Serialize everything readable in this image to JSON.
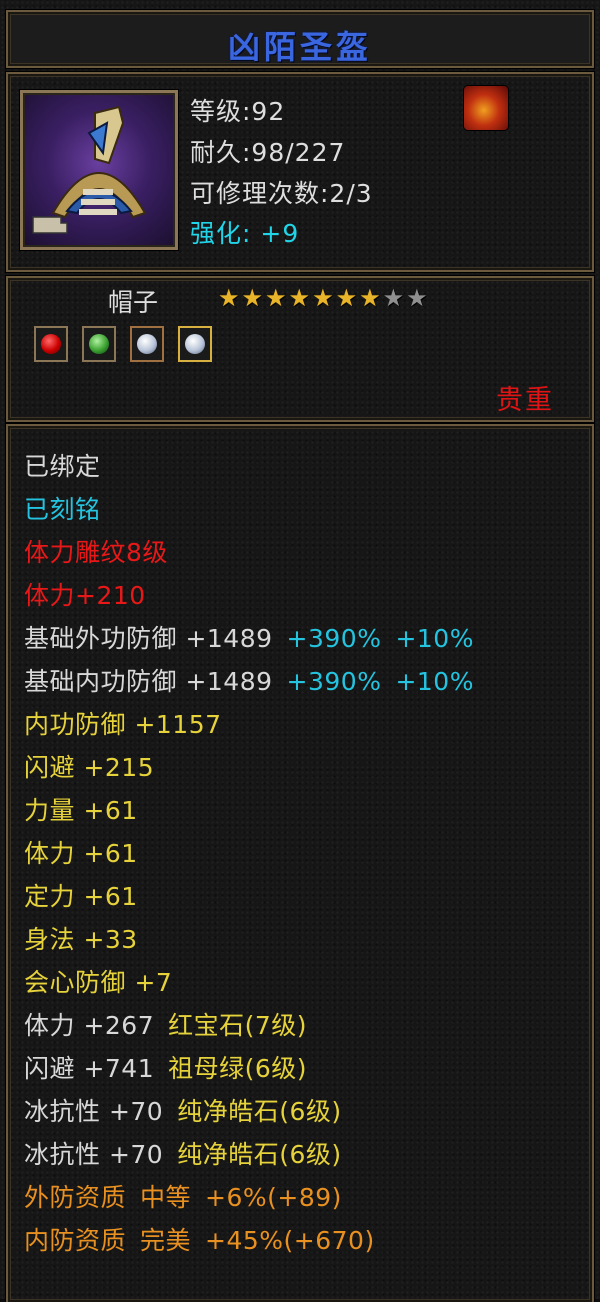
{
  "item": {
    "title": "凶陌圣盔",
    "level": "等级:92",
    "durability": "耐久:98/227",
    "repair": "可修理次数:2/3",
    "enhance": "强化: +9",
    "type": "帽子",
    "stars_filled": 7,
    "stars_total": 9,
    "rarity": "贵重",
    "icon": "helmet-icon"
  },
  "gems": [
    {
      "icon": "red-gem-icon"
    },
    {
      "icon": "green-gem-icon"
    },
    {
      "icon": "white-gem-icon"
    },
    {
      "icon": "white-gem-icon"
    }
  ],
  "colors": {
    "title": "#3a66e0",
    "cyan": "#24c4e0",
    "red": "#e81818",
    "yellow": "#e6d23a",
    "orange": "#e89020",
    "white": "#d8d8d8",
    "star_on": "#e8b52a",
    "star_off": "#8f8f8f"
  },
  "attributes": [
    {
      "segments": [
        {
          "text": "已绑定",
          "color": "white"
        }
      ]
    },
    {
      "segments": [
        {
          "text": "已刻铭",
          "color": "cyan"
        }
      ]
    },
    {
      "segments": [
        {
          "text": "体力雕纹8级",
          "color": "red"
        }
      ]
    },
    {
      "segments": [
        {
          "text": "体力+210",
          "color": "red"
        }
      ]
    },
    {
      "segments": [
        {
          "text": "基础外功防御 +1489",
          "color": "white"
        },
        {
          "text": "+390%",
          "color": "cyan"
        },
        {
          "text": "+10%",
          "color": "cyan"
        }
      ]
    },
    {
      "segments": [
        {
          "text": "基础内功防御 +1489",
          "color": "white"
        },
        {
          "text": "+390%",
          "color": "cyan"
        },
        {
          "text": "+10%",
          "color": "cyan"
        }
      ]
    },
    {
      "segments": [
        {
          "text": "内功防御 +1157",
          "color": "yellow"
        }
      ]
    },
    {
      "segments": [
        {
          "text": "闪避 +215",
          "color": "yellow"
        }
      ]
    },
    {
      "segments": [
        {
          "text": "力量 +61",
          "color": "yellow"
        }
      ]
    },
    {
      "segments": [
        {
          "text": "体力 +61",
          "color": "yellow"
        }
      ]
    },
    {
      "segments": [
        {
          "text": "定力 +61",
          "color": "yellow"
        }
      ]
    },
    {
      "segments": [
        {
          "text": "身法 +33",
          "color": "yellow"
        }
      ]
    },
    {
      "segments": [
        {
          "text": "会心防御 +7",
          "color": "yellow"
        }
      ]
    },
    {
      "segments": [
        {
          "text": "体力 +267",
          "color": "white"
        },
        {
          "text": "红宝石(7级)",
          "color": "yellow"
        }
      ]
    },
    {
      "segments": [
        {
          "text": "闪避 +741",
          "color": "white"
        },
        {
          "text": "祖母绿(6级)",
          "color": "yellow"
        }
      ]
    },
    {
      "segments": [
        {
          "text": "冰抗性 +70",
          "color": "white"
        },
        {
          "text": "纯净皓石(6级)",
          "color": "yellow"
        }
      ]
    },
    {
      "segments": [
        {
          "text": "冰抗性 +70",
          "color": "white"
        },
        {
          "text": "纯净皓石(6级)",
          "color": "yellow"
        }
      ]
    },
    {
      "segments": [
        {
          "text": "外防资质",
          "color": "orange"
        },
        {
          "text": "中等",
          "color": "orange"
        },
        {
          "text": "+6%(+89)",
          "color": "orange"
        }
      ]
    },
    {
      "segments": [
        {
          "text": "内防资质",
          "color": "orange"
        },
        {
          "text": "完美",
          "color": "orange"
        },
        {
          "text": "+45%(+670)",
          "color": "orange"
        }
      ]
    }
  ]
}
